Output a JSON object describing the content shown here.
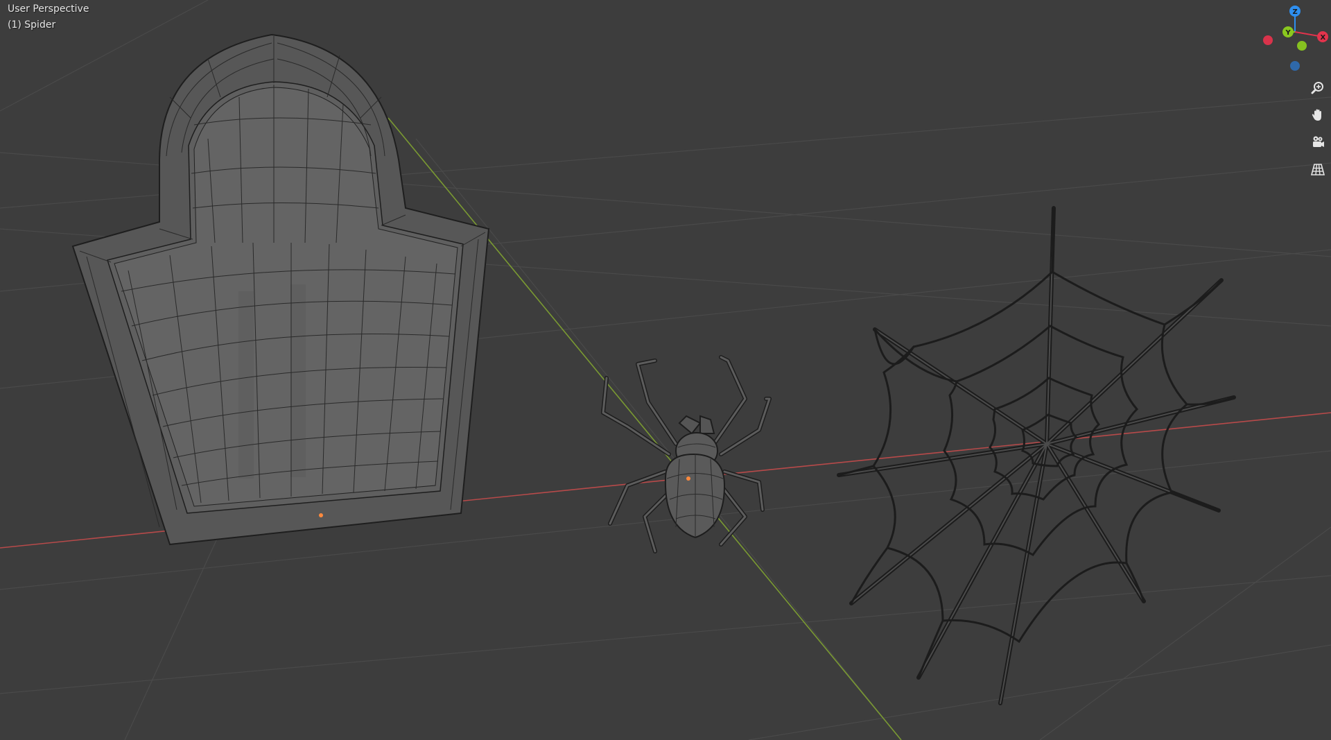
{
  "viewport": {
    "view_name": "User Perspective",
    "active_object": "(1) Spider"
  },
  "gizmo": {
    "z_label": "Z",
    "y_label": "Y",
    "x_label": "X",
    "colors": {
      "x": "#e2334c",
      "y": "#8ac81f",
      "z": "#2e8ff0"
    }
  },
  "nav_buttons": [
    {
      "icon": "zoom-icon"
    },
    {
      "icon": "hand-pan-icon"
    },
    {
      "icon": "camera-icon"
    },
    {
      "icon": "grid-perspective-icon"
    }
  ],
  "scene_objects": [
    {
      "name": "gravestone",
      "type": "mesh"
    },
    {
      "name": "spider",
      "type": "mesh"
    },
    {
      "name": "spider-web",
      "type": "mesh"
    }
  ],
  "colors": {
    "background": "#3d3d3d",
    "grid": "#4a4a4a",
    "x_axis_line": "#b84a4a",
    "y_axis_line": "#7a9a32",
    "wire": "#1f1f1f",
    "origin": "#ff8a3d"
  }
}
